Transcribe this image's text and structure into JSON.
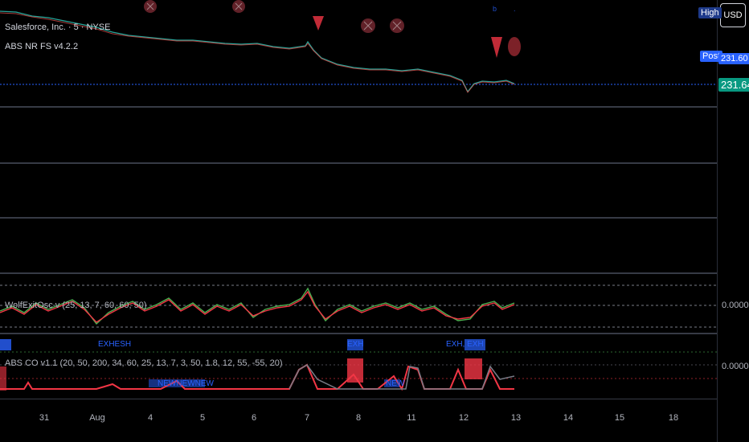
{
  "symbol": {
    "title": "Salesforce, Inc. · 5 · NYSE",
    "indicator1": "ABS NR FS v4.2.2"
  },
  "price_scale": {
    "currency_button": "USD",
    "high_tag": "High",
    "post_tag": "Post",
    "post_price": "231.60",
    "last_price": "231.64",
    "accent_blue": "#2962ff",
    "accent_teal": "#089981"
  },
  "panes": {
    "wolf": {
      "legend": "WolfExitOsc v (25, 13, 7, 60, 60, 50)",
      "value": "0.0000"
    },
    "abs_co": {
      "legend": "ABS CO v1.1 (20, 50, 200, 34, 60, 25, 13, 7, 3, 50, 1.8, 12, 55, -55, 20)",
      "value": "0.0000",
      "tags_top": [
        "EXHESH",
        "EXH",
        "EXH, EXH"
      ],
      "tags_bottom": [
        "NEWNEWNEW",
        "NEW"
      ]
    }
  },
  "time_axis": {
    "labels": [
      "31",
      "Aug",
      "4",
      "5",
      "6",
      "7",
      "8",
      "11",
      "12",
      "13",
      "14",
      "15",
      "18"
    ]
  }
}
